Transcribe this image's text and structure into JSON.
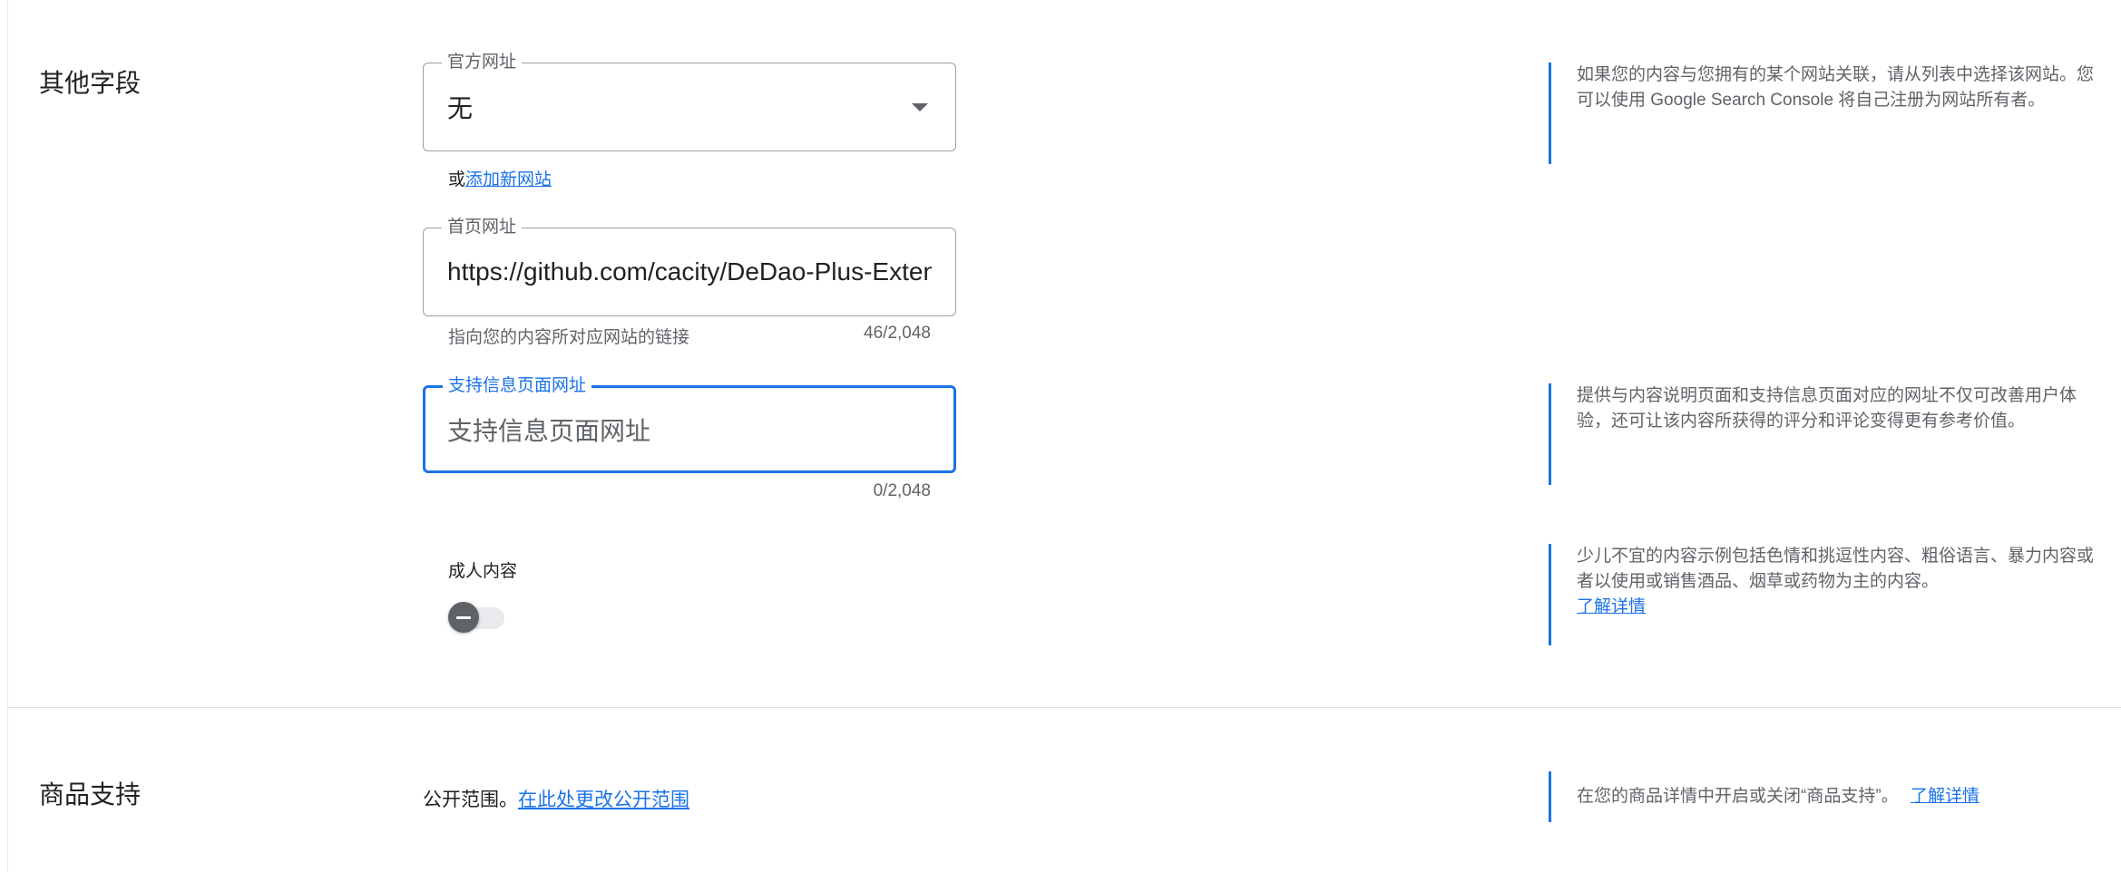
{
  "other_fields": {
    "title": "其他字段",
    "official_url": {
      "label": "官方网址",
      "value": "无",
      "or_text": "或",
      "add_link": "添加新网站",
      "note": "如果您的内容与您拥有的某个网站关联，请从列表中选择该网站。您可以使用 Google Search Console 将自己注册为网站所有者。"
    },
    "homepage_url": {
      "label": "首页网址",
      "value": "https://github.com/cacity/DeDao-Plus-Extension",
      "helper": "指向您的内容所对应网站的链接",
      "counter": "46/2,048"
    },
    "support_url": {
      "label": "支持信息页面网址",
      "placeholder": "支持信息页面网址",
      "counter": "0/2,048",
      "note": "提供与内容说明页面和支持信息页面对应的网址不仅可改善用户体验，还可让该内容所获得的评分和评论变得更有参考价值。"
    },
    "mature_content": {
      "label": "成人内容",
      "toggle_state": "off",
      "note": "少儿不宜的内容示例包括色情和挑逗性内容、粗俗语言、暴力内容或者以使用或销售酒品、烟草或药物为主的内容。",
      "learn_more": "了解详情"
    }
  },
  "item_support": {
    "title": "商品支持",
    "visibility_text": "公开范围。",
    "visibility_link": "在此处更改公开范围",
    "note": "在您的商品详情中开启或关闭“商品支持”。",
    "learn_more": "了解详情"
  },
  "colors": {
    "accent": "#1a73e8",
    "border": "#9aa0a6",
    "muted_text": "#5f6368"
  }
}
